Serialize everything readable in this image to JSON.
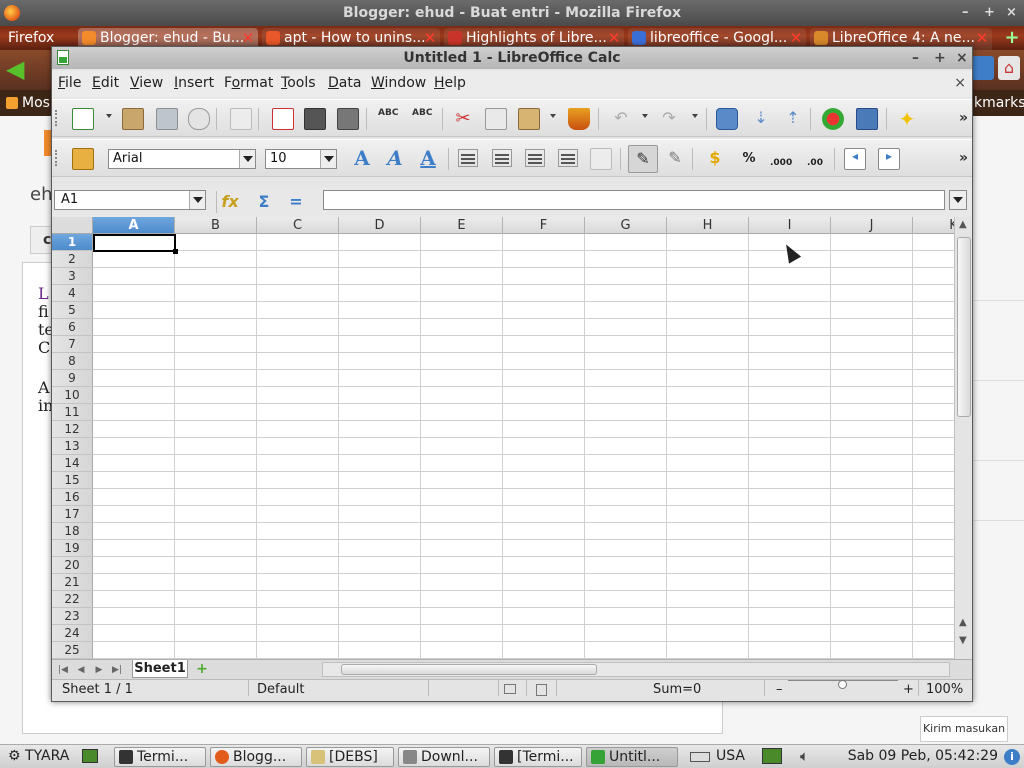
{
  "firefox": {
    "title": "Blogger: ehud - Buat entri - Mozilla Firefox",
    "menu_button": "Firefox",
    "tabs": [
      {
        "label": "Blogger: ehud - Bu...",
        "fav_color": "#f48c2c"
      },
      {
        "label": "apt - How to unins...",
        "fav_color": "#e8582a"
      },
      {
        "label": "Highlights of Libre...",
        "fav_color": "#c8342a"
      },
      {
        "label": "libreoffice - Googl...",
        "fav_color": "#3a6fd8"
      },
      {
        "label": "LibreOffice 4: A ne...",
        "fav_color": "#d88a2a"
      }
    ],
    "bookmarks_left": "Mos",
    "bookmarks_right": "kmarks",
    "window_controls": {
      "min": "–",
      "max": "+",
      "close": "×"
    }
  },
  "blog": {
    "editor_initial": "eh",
    "btn_initial": "c",
    "text_lines": [
      "L",
      "fi",
      "te",
      "C",
      "A",
      "in"
    ],
    "kirim": "Kirim masukan"
  },
  "calc": {
    "title": "Untitled 1 - LibreOffice Calc",
    "window_controls": {
      "min": "–",
      "max": "+",
      "close": "×"
    },
    "menu": [
      {
        "label": "File",
        "key": "F"
      },
      {
        "label": "Edit",
        "key": "E"
      },
      {
        "label": "View",
        "key": "V"
      },
      {
        "label": "Insert",
        "key": "I"
      },
      {
        "label": "Format",
        "key": "o"
      },
      {
        "label": "Tools",
        "key": "T"
      },
      {
        "label": "Data",
        "key": "D"
      },
      {
        "label": "Window",
        "key": "W"
      },
      {
        "label": "Help",
        "key": "H"
      }
    ],
    "doc_close": "×",
    "font_name": "Arial",
    "font_size": "10",
    "name_box": "A1",
    "formula_value": "",
    "fx_label": "fx",
    "sum_label": "Σ",
    "eq_label": "=",
    "columns": [
      "A",
      "B",
      "C",
      "D",
      "E",
      "F",
      "G",
      "H",
      "I",
      "J",
      "K"
    ],
    "rows": [
      "1",
      "2",
      "3",
      "4",
      "5",
      "6",
      "7",
      "8",
      "9",
      "10",
      "11",
      "12",
      "13",
      "14",
      "15",
      "16",
      "17",
      "18",
      "19",
      "20",
      "21",
      "22",
      "23",
      "24",
      "25"
    ],
    "selected_col": "A",
    "selected_row": "1",
    "sheet_tab": "Sheet1",
    "add_sheet": "+",
    "status": {
      "sheet": "Sheet 1 / 1",
      "style": "Default",
      "sum": "Sum=0",
      "zoom_minus": "–",
      "zoom_plus": "+",
      "zoom": "100%"
    },
    "toolbar_more": "»"
  },
  "taskbar": {
    "start_label": "TYARA",
    "items": [
      {
        "label": "Termi...",
        "color": "#333333"
      },
      {
        "label": "Blogg...",
        "color": "#e35b1a"
      },
      {
        "label": "[DEBS]",
        "color": "#d8c27a"
      },
      {
        "label": "Downl...",
        "color": "#888888"
      },
      {
        "label": "[Termi...",
        "color": "#333333"
      },
      {
        "label": "Untitl...",
        "color": "#36a336"
      }
    ],
    "keyboard": "USA",
    "clock": "Sab 09 Peb, 05:42:29"
  }
}
